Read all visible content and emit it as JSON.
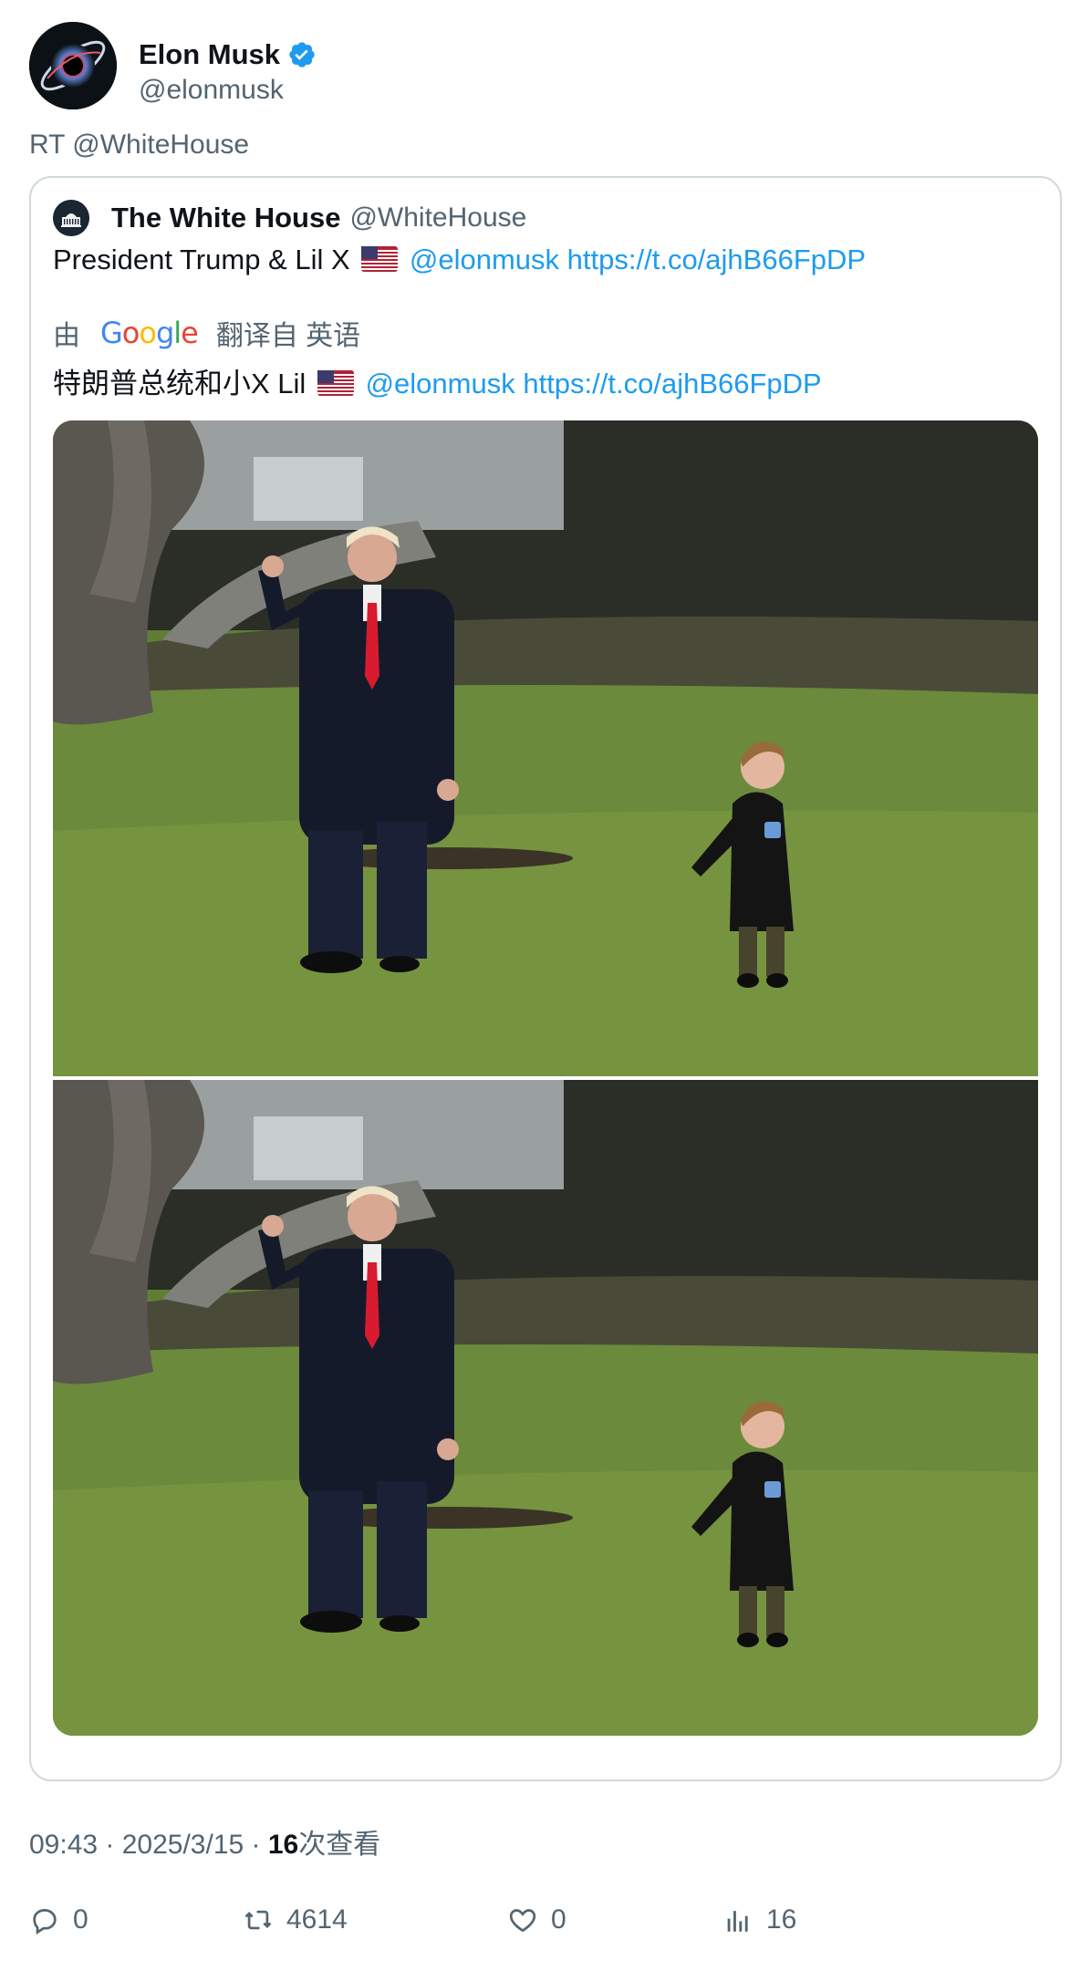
{
  "author": {
    "name": "Elon Musk",
    "handle": "@elonmusk",
    "verified": true
  },
  "retweet_line": "RT @WhiteHouse",
  "quoted": {
    "name": "The White House",
    "handle": "@WhiteHouse",
    "text_prefix": "President Trump & Lil X",
    "mention": "@elonmusk",
    "url": "https://t.co/ajhB66FpDP",
    "flag": "US flag",
    "translation": {
      "by": "由",
      "provider": "Google",
      "from_label": "翻译自 英语",
      "text_prefix": "特朗普总统和小X Lil",
      "mention": "@elonmusk",
      "url": "https://t.co/ajhB66FpDP"
    },
    "media_count": 2
  },
  "meta": {
    "time_date": "09:43 · 2025/3/15 · ",
    "views_count": "16",
    "views_label": "次查看"
  },
  "actions": {
    "replies": "0",
    "retweets": "4614",
    "likes": "0",
    "views": "16"
  },
  "colors": {
    "link": "#1d9bf0",
    "secondary_text": "#536471",
    "verified": "#1d9bf0",
    "border": "#cfd9de"
  }
}
